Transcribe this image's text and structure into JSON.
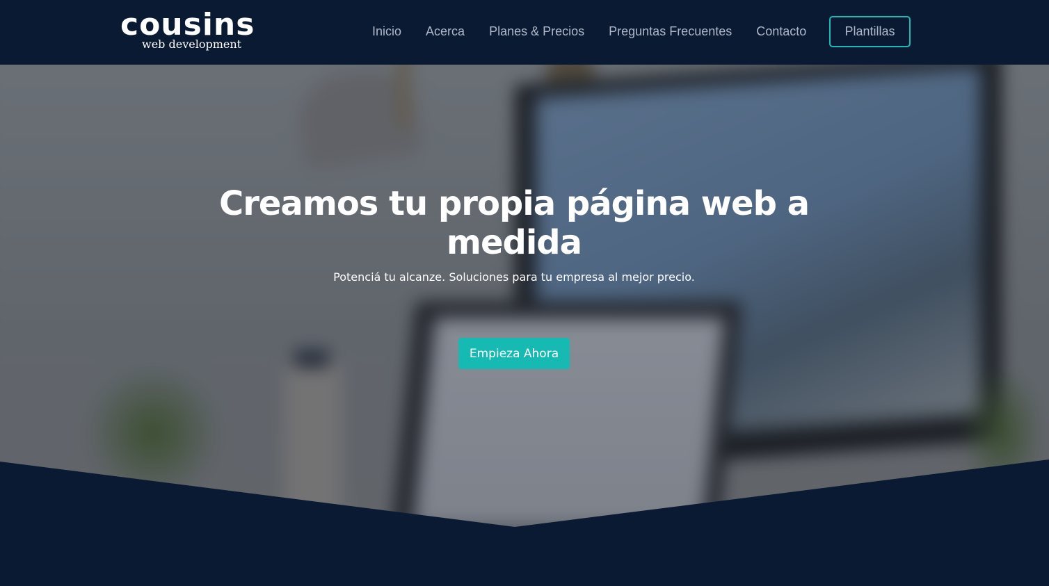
{
  "colors": {
    "navy": "#0b1a33",
    "accent_teal": "#16bab3",
    "nav_text": "#aeb8c8"
  },
  "header": {
    "logo_word": "cousins",
    "logo_sub": "web development",
    "nav": [
      "Inicio",
      "Acerca",
      "Planes & Precios",
      "Preguntas Frecuentes",
      "Contacto"
    ],
    "cta_label": "Plantillas"
  },
  "hero": {
    "title": "Creamos tu propia página web a medida",
    "subtitle": "Potenciá tu alcanze. Soluciones para tu empresa al mejor precio.",
    "button_label": "Empieza Ahora"
  }
}
